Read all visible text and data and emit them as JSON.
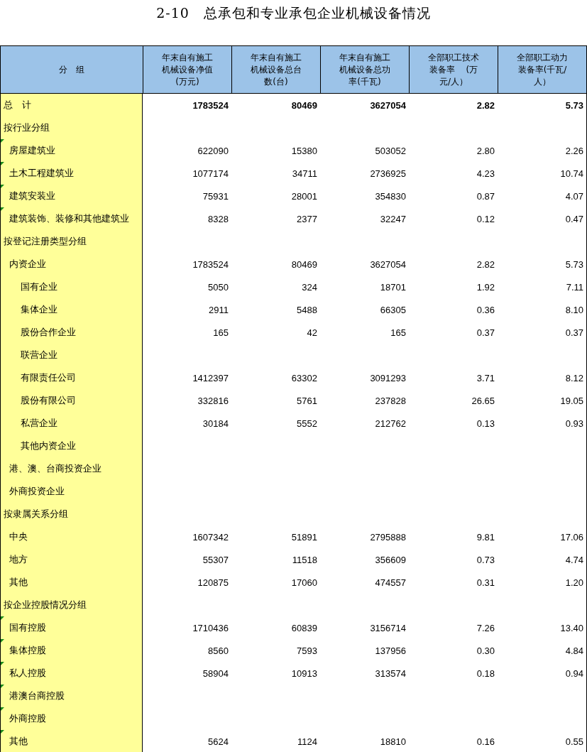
{
  "title": "2-10　总承包和专业承包企业机械设备情况",
  "table": {
    "columns": [
      "分　组",
      "年末自有施工机械设备净值(万元)",
      "年末自有施工机械设备总台数(台)",
      "年末自有施工机械设备总功率(千瓦)",
      "全部职工技术装备率　 (万元/人）",
      "全部职工动力装备率(千瓦/人）"
    ],
    "rows": [
      {
        "kind": "total",
        "label": "总　计",
        "values": [
          "1783524",
          "80469",
          "3627054",
          "2.82",
          "5.73"
        ]
      },
      {
        "kind": "group",
        "label": "按行业分组",
        "children": [
          {
            "kind": "item",
            "label": "房屋建筑业",
            "flag": true,
            "values": [
              "622090",
              "15380",
              "503052",
              "2.80",
              "2.26"
            ]
          },
          {
            "kind": "item",
            "label": "土木工程建筑业",
            "flag": true,
            "values": [
              "1077174",
              "34711",
              "2736925",
              "4.23",
              "10.74"
            ]
          },
          {
            "kind": "item",
            "label": "建筑安装业",
            "flag": true,
            "values": [
              "75931",
              "28001",
              "354830",
              "0.87",
              "4.07"
            ]
          },
          {
            "kind": "item",
            "label": "建筑装饰、装修和其他建筑业",
            "flag": true,
            "values": [
              "8328",
              "2377",
              "32247",
              "0.12",
              "0.47"
            ]
          }
        ]
      },
      {
        "kind": "group",
        "label": "按登记注册类型分组",
        "children": [
          {
            "kind": "item",
            "label": "内资企业",
            "values": [
              "1783524",
              "80469",
              "3627054",
              "2.82",
              "5.73"
            ],
            "children": [
              {
                "kind": "item",
                "label": "国有企业",
                "values": [
                  "5050",
                  "324",
                  "18701",
                  "1.92",
                  "7.11"
                ]
              },
              {
                "kind": "item",
                "label": "集体企业",
                "values": [
                  "2911",
                  "5488",
                  "66305",
                  "0.36",
                  "8.10"
                ]
              },
              {
                "kind": "item",
                "label": "股份合作企业",
                "values": [
                  "165",
                  "42",
                  "165",
                  "0.37",
                  "0.37"
                ]
              },
              {
                "kind": "item",
                "label": "联营企业"
              },
              {
                "kind": "item",
                "label": "有限责任公司",
                "values": [
                  "1412397",
                  "63302",
                  "3091293",
                  "3.71",
                  "8.12"
                ]
              },
              {
                "kind": "item",
                "label": "股份有限公司",
                "values": [
                  "332816",
                  "5761",
                  "237828",
                  "26.65",
                  "19.05"
                ]
              },
              {
                "kind": "item",
                "label": "私营企业",
                "values": [
                  "30184",
                  "5552",
                  "212762",
                  "0.13",
                  "0.93"
                ]
              },
              {
                "kind": "item",
                "label": "其他内资企业"
              }
            ]
          },
          {
            "kind": "item",
            "label": "港、澳、台商投资企业"
          },
          {
            "kind": "item",
            "label": "外商投资企业"
          }
        ]
      },
      {
        "kind": "group",
        "label": "按隶属关系分组",
        "children": [
          {
            "kind": "item",
            "label": "中央",
            "values": [
              "1607342",
              "51891",
              "2795888",
              "9.81",
              "17.06"
            ]
          },
          {
            "kind": "item",
            "label": "地方",
            "values": [
              "55307",
              "11518",
              "356609",
              "0.73",
              "4.74"
            ]
          },
          {
            "kind": "item",
            "label": "其他",
            "values": [
              "120875",
              "17060",
              "474557",
              "0.31",
              "1.20"
            ]
          }
        ]
      },
      {
        "kind": "group",
        "label": "按企业控股情况分组",
        "children": [
          {
            "kind": "item",
            "label": "国有控股",
            "flag": true,
            "values": [
              "1710436",
              "60839",
              "3156714",
              "7.26",
              "13.40"
            ]
          },
          {
            "kind": "item",
            "label": "集体控股",
            "flag": true,
            "values": [
              "8560",
              "7593",
              "137956",
              "0.30",
              "4.84"
            ]
          },
          {
            "kind": "item",
            "label": "私人控股",
            "flag": true,
            "values": [
              "58904",
              "10913",
              "313574",
              "0.18",
              "0.94"
            ]
          },
          {
            "kind": "item",
            "label": "港澳台商控股",
            "flag": true
          },
          {
            "kind": "item",
            "label": "外商控股",
            "flag": true
          },
          {
            "kind": "item",
            "label": "其他",
            "flag": true,
            "values": [
              "5624",
              "1124",
              "18810",
              "0.16",
              "0.55"
            ]
          }
        ]
      }
    ]
  }
}
